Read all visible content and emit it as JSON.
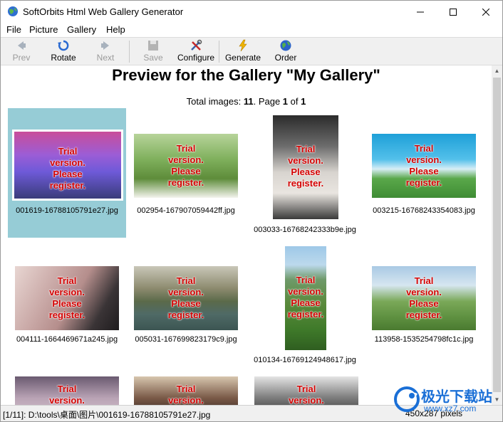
{
  "window": {
    "title": "SoftOrbits Html Web Gallery Generator",
    "controls": {
      "minimize": "minimize",
      "maximize": "maximize",
      "close": "close"
    }
  },
  "menu": [
    "File",
    "Picture",
    "Gallery",
    "Help"
  ],
  "toolbar": {
    "prev": "Prev",
    "rotate": "Rotate",
    "next": "Next",
    "save": "Save",
    "configure": "Configure",
    "generate": "Generate",
    "order": "Order"
  },
  "preview": {
    "heading": "Preview for the Gallery \"My Gallery\"",
    "totals_prefix": "Total images: ",
    "total_images": "11",
    "page_prefix": ". Page ",
    "page": "1",
    "of_label": " of ",
    "pages": "1",
    "watermark_lines": [
      "Trial",
      "version.",
      "Please",
      "register."
    ]
  },
  "images": [
    {
      "filename": "001619-16788105791e27.jpg",
      "selected": true
    },
    {
      "filename": "002954-167907059442ff.jpg",
      "selected": false
    },
    {
      "filename": "003033-16768242333b9e.jpg",
      "selected": false
    },
    {
      "filename": "003215-16768243354083.jpg",
      "selected": false
    },
    {
      "filename": "004111-1664469671a245.jpg",
      "selected": false
    },
    {
      "filename": "005031-167699823179c9.jpg",
      "selected": false
    },
    {
      "filename": "010134-16769124948617.jpg",
      "selected": false
    },
    {
      "filename": "113958-1535254798fc1c.jpg",
      "selected": false
    },
    {
      "filename": "",
      "selected": false
    },
    {
      "filename": "",
      "selected": false
    },
    {
      "filename": "",
      "selected": false
    }
  ],
  "status": {
    "left": "[1/11]: D:\\tools\\桌面\\图片\\001619-16788105791e27.jpg",
    "right": "450x287 pixels"
  },
  "site_watermark": {
    "main": "极光下载站",
    "sub": "www.xz7.com"
  }
}
